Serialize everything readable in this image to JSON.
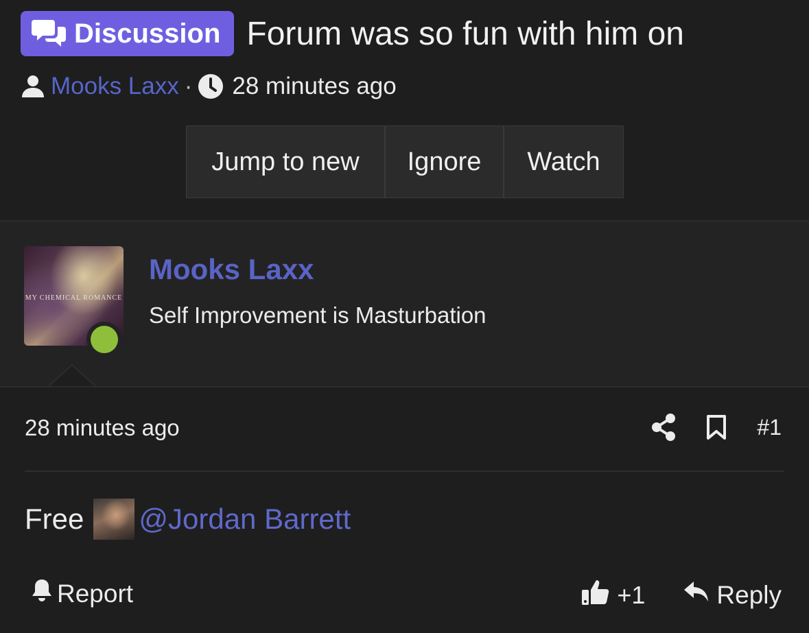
{
  "thread": {
    "prefix_label": "Discussion",
    "title": "Forum was so fun with him on",
    "author": "Mooks Laxx",
    "separator": "·",
    "time": "28 minutes ago"
  },
  "thread_actions": {
    "jump_label": "Jump to new",
    "ignore_label": "Ignore",
    "watch_label": "Watch"
  },
  "post": {
    "username": "Mooks Laxx",
    "user_title": "Self Improvement is Masturbation",
    "avatar_caption": "MY CHEMICAL ROMANCE",
    "online": true,
    "time": "28 minutes ago",
    "number": "#1",
    "body_text": "Free",
    "mention": "@Jordan Barrett",
    "report_label": "Report",
    "reaction_count": "+1",
    "reply_label": "Reply"
  },
  "icons": {
    "prefix": "comments-icon",
    "author": "user-icon",
    "time": "clock-icon",
    "share": "share-icon",
    "bookmark": "bookmark-icon",
    "report": "bell-icon",
    "like": "thumbs-up-icon",
    "reply": "reply-icon"
  },
  "colors": {
    "background": "#1e1e1f",
    "prefix_badge": "#6f5fe0",
    "link": "#5a63c6",
    "online": "#8fbf3a"
  }
}
